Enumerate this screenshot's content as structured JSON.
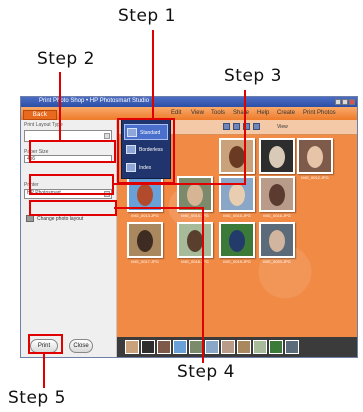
{
  "callouts": {
    "step1": "Step 1",
    "step2": "Step 2",
    "step3": "Step 3",
    "step4": "Step 4",
    "step5": "Step 5"
  },
  "app": {
    "title": "Print Photo Shop • HP Photosmart Studio",
    "back_label": "Back",
    "menu": [
      "Edit",
      "View",
      "Tools",
      "Share",
      "Help",
      "Create",
      "Print Photos"
    ],
    "toolbar": {
      "view_label": "View"
    }
  },
  "left_panel": {
    "layout_label": "Print Layout Type",
    "layout_value": "",
    "size_label": "Paper Size",
    "size_value": "4x6",
    "printer_label": "Printer",
    "printer_value": "HP Photosmart",
    "change_layout_link": "Change photo layout",
    "print_button": "Print",
    "close_button": "Close"
  },
  "popup": {
    "items": [
      {
        "label": "Standard",
        "icon": "layout-icon",
        "selected": true
      },
      {
        "label": "Borderless",
        "icon": "layout-icon",
        "selected": false
      },
      {
        "label": "Index",
        "icon": "layout-icon",
        "selected": false
      }
    ]
  },
  "gallery": {
    "thumbnails": [
      {
        "caption": "IMG_0010.JPG",
        "bg": "#c9a17a",
        "fg": "#6b3a22"
      },
      {
        "caption": "IMG_0011.JPG",
        "bg": "#2d2d2d",
        "fg": "#d9c9b7"
      },
      {
        "caption": "IMG_0012.JPG",
        "bg": "#7d5a4a",
        "fg": "#e7c3a8"
      },
      {
        "caption": "IMG_0013.JPG",
        "bg": "#6aa0d8",
        "fg": "#b14b2c"
      },
      {
        "caption": "IMG_0014.JPG",
        "bg": "#7a8a6a",
        "fg": "#d6b594"
      },
      {
        "caption": "IMG_0015.JPG",
        "bg": "#8aa7c8",
        "fg": "#e8cdb1"
      },
      {
        "caption": "IMG_0016.JPG",
        "bg": "#b99b8a",
        "fg": "#5b3b30"
      },
      {
        "caption": "IMG_0017.JPG",
        "bg": "#a9885f",
        "fg": "#3e2c22"
      },
      {
        "caption": "IMG_0018.JPG",
        "bg": "#a7bb9a",
        "fg": "#5a3e2e"
      },
      {
        "caption": "IMG_0019.JPG",
        "bg": "#3c7a3a",
        "fg": "#223b6b"
      },
      {
        "caption": "IMG_0020.JPG",
        "bg": "#5b6b7a",
        "fg": "#d1b59e"
      }
    ]
  },
  "colors": {
    "accent_orange": "#f08a45",
    "callout_red": "#e00000",
    "popup_blue": "#20356d"
  }
}
